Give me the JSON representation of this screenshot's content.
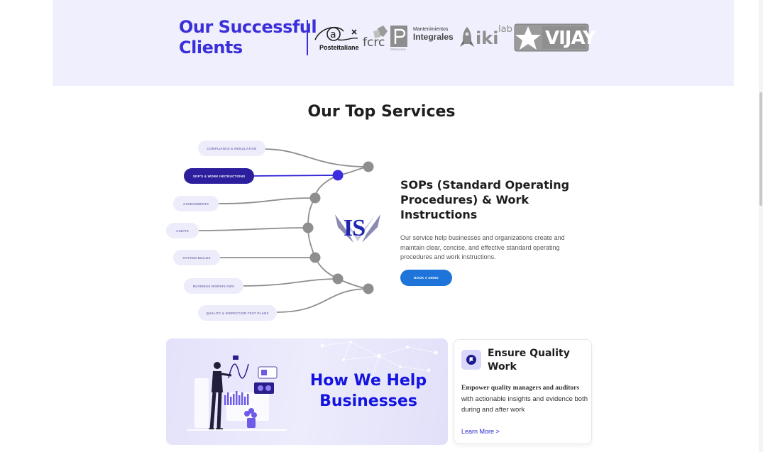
{
  "clients": {
    "title_line1": "Our Successful",
    "title_line2": "Clients",
    "logos": {
      "poste": "Posteitaliane",
      "fcrc": "fcrc",
      "provigh": "PROVIGH",
      "mant_line1": "Mantenimientos",
      "mant_line2": "Integrales",
      "aiki": "iki",
      "aiki_lab": "lab",
      "vijay": "VIJAY"
    }
  },
  "services": {
    "title": "Our Top Services",
    "pills": [
      "Compliance & Regulation",
      "SOP's & Work Instructions",
      "Assessments",
      "Audits",
      "System Builds",
      "Business Workflows",
      "Quality & Inspection Test Plans"
    ],
    "logo_text": "IS",
    "heading": "SOPs (Standard Operating Procedures) & Work Instructions",
    "description": "Our service help businesses and organizations create and maintain clear, concise, and effective standard operating procedures and work instructions.",
    "button": "Book a Demo"
  },
  "help": {
    "title_line1": "How We Help",
    "title_line2": "Businesses"
  },
  "quality": {
    "title": "Ensure Quality Work",
    "desc_first": "Empower quality managers and auditors",
    "desc_rest": "with actionable insights and evidence both during and after work",
    "link": "Learn More >"
  },
  "colors": {
    "accent": "#3a2fd8",
    "band_bg": "#efeffd",
    "active_pill": "#2c1f9e",
    "button": "#1e74d8",
    "help_title": "#1414e0"
  }
}
